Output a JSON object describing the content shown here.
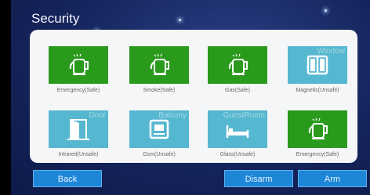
{
  "screen": {
    "title": "Security"
  },
  "tiles": [
    {
      "label": "Emergency(Safe)",
      "ghost": "",
      "icon": "kettle-icon",
      "state": "safe"
    },
    {
      "label": "Smoke(Safe)",
      "ghost": "",
      "icon": "kettle-icon",
      "state": "safe"
    },
    {
      "label": "Gas(Safe)",
      "ghost": "",
      "icon": "kettle-icon",
      "state": "safe"
    },
    {
      "label": "Magnetic(Unsafe)",
      "ghost": "Window",
      "icon": "window-icon",
      "state": "unsafe"
    },
    {
      "label": "Infrared(Unsafe)",
      "ghost": "Door",
      "icon": "door-icon",
      "state": "unsafe"
    },
    {
      "label": "Gsm(Unsafe)",
      "ghost": "Balcony",
      "icon": "balcony-icon",
      "state": "unsafe"
    },
    {
      "label": "Glass(Unsafe)",
      "ghost": "GuestRoom",
      "icon": "bed-icon",
      "state": "unsafe"
    },
    {
      "label": "Emergency(Safe)",
      "ghost": "",
      "icon": "kettle-icon",
      "state": "safe"
    }
  ],
  "buttons": {
    "back": "Back",
    "disarm": "Disarm",
    "arm": "Arm"
  },
  "colors": {
    "safe": "#2a9a1d",
    "unsafe": "#56b7d0",
    "button": "#1e86d6",
    "panel": "#f4f6f8"
  }
}
